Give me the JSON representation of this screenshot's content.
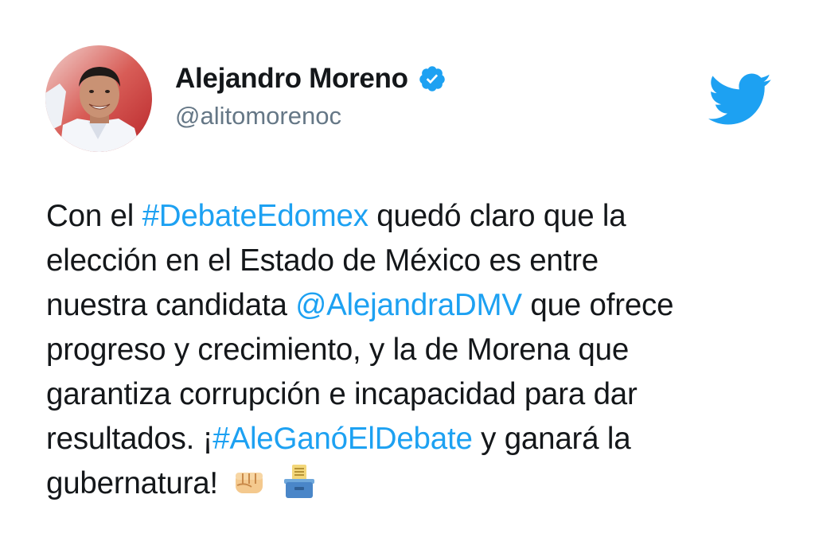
{
  "user": {
    "display_name": "Alejandro Moreno",
    "handle": "@alitomorenoc",
    "verified": true
  },
  "icons": {
    "avatar": "profile-photo",
    "verified": "verified-badge-icon",
    "logo": "twitter-bird-icon",
    "emoji_1": "oncoming-fist-emoji",
    "emoji_2": "ballot-box-emoji"
  },
  "colors": {
    "link": "#1da1f2",
    "text": "#14171a",
    "handle": "#657786",
    "brand": "#1da1f2"
  },
  "tweet": {
    "line1_a": "Con el ",
    "line1_hashtag": "#DebateEdomex",
    "line1_b": " quedó claro que la",
    "line2": "elección en el Estado de México es entre",
    "line3_a": "nuestra candidata ",
    "line3_mention": "@AlejandraDMV",
    "line3_b": " que ofrece",
    "line4": "progreso y crecimiento, y la de Morena que",
    "line5": "garantiza corrupción e incapacidad para dar",
    "line6_a": "resultados. ¡",
    "line6_hashtag": "#AleGanóElDebate",
    "line6_b": " y ganará la",
    "line7": "gubernatura!"
  }
}
